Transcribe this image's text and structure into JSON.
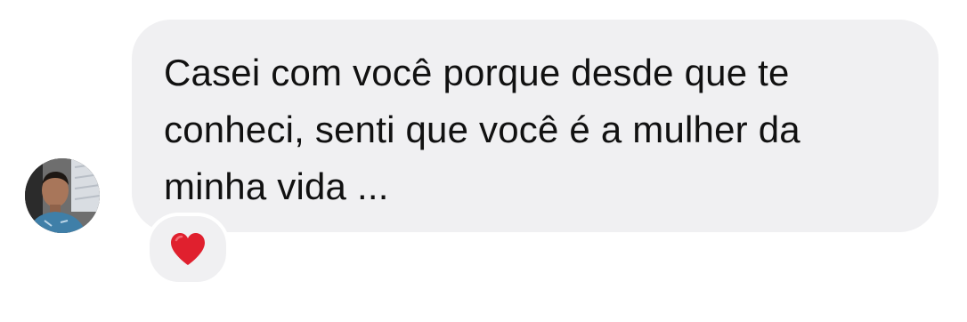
{
  "message": {
    "text": "Casei com você porque desde que te conheci, senti que você é a mulher da minha vida ...",
    "bubble_color": "#f0f0f2",
    "text_color": "#111111"
  },
  "sender": {
    "avatar_icon": "profile-photo"
  },
  "reaction": {
    "icon": "red-heart-icon",
    "color": "#e0202e"
  }
}
